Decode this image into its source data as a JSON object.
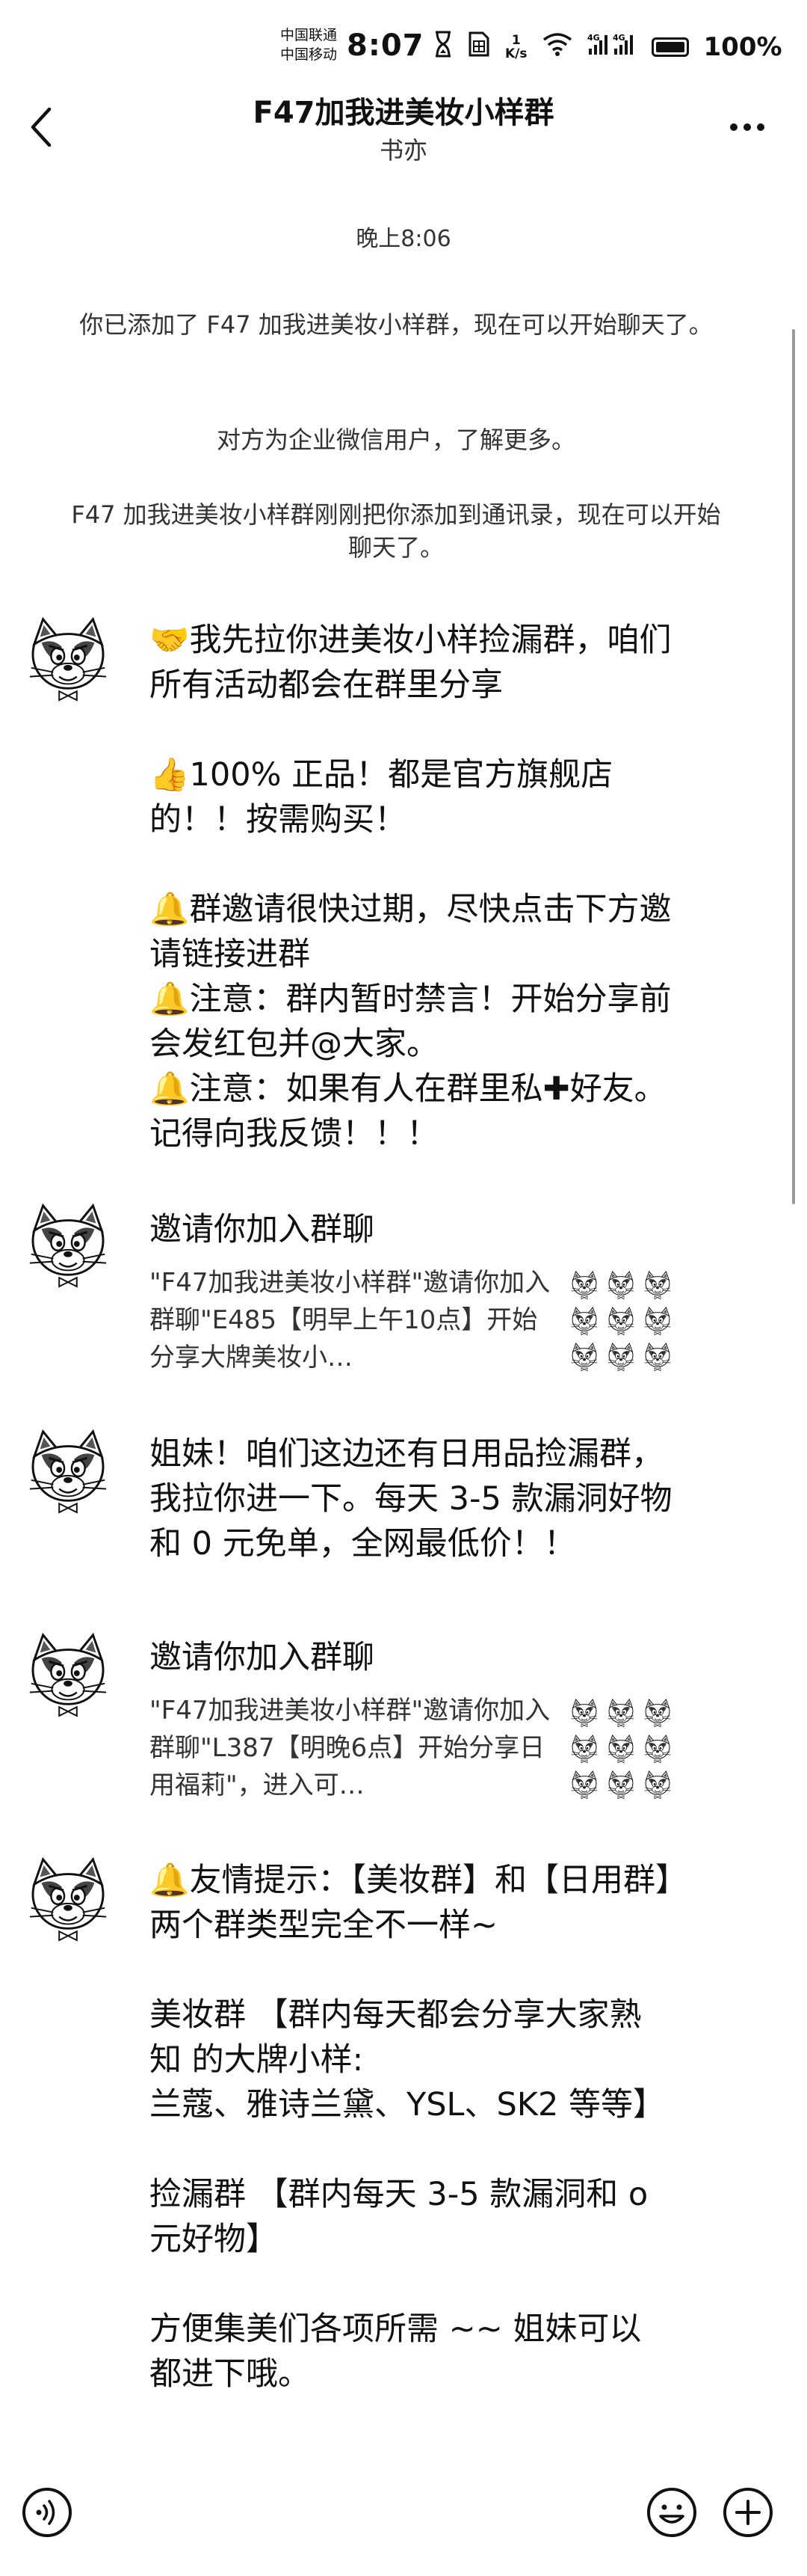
{
  "status_bar": {
    "carrier_1": "中国联通",
    "carrier_2": "中国移动",
    "time": "8:07",
    "net_speed_value": "1",
    "net_speed_unit": "K/s",
    "network_1": "4G",
    "network_2": "4G",
    "battery": "100%",
    "icons": [
      "hourglass-icon",
      "sim-icon",
      "wifi-icon",
      "signal-icon",
      "battery-icon"
    ]
  },
  "nav": {
    "title": "F47加我进美妆小样群",
    "subtitle": "书亦",
    "back_icon": "back-chevron-icon",
    "more_icon": "more-dots-icon"
  },
  "system_messages": {
    "timestamp": "晚上8:06",
    "added": "你已添加了 F47 加我进美妆小样群，现在可以开始聊天了。",
    "enterprise": "对方为企业微信用户，了解更多。",
    "contact_added": "F47 加我进美妆小样群刚刚把你添加到通讯录，现在可以开始聊天了。"
  },
  "messages": [
    {
      "type": "text",
      "text": "🤝我先拉你进美妆小样捡漏群，咱们所有活动都会在群里分享\n\n👍100% 正品！都是官方旗舰店的！！按需购买！\n\n🔔群邀请很快过期，尽快点击下方邀请链接进群\n🔔注意：群内暂时禁言！开始分享前会发红包并@大家。\n🔔注意：如果有人在群里私✚好友。记得向我反馈！！！"
    },
    {
      "type": "card",
      "title": "邀请你加入群聊",
      "description": "\"F47加我进美妆小样群\"邀请你加入群聊\"E485【明早上午10点】开始分享大牌美妆小…"
    },
    {
      "type": "text",
      "text": "姐妹！咱们这边还有日用品捡漏群，我拉你进一下。每天 3-5 款漏洞好物和 0 元免单，全网最低价！！"
    },
    {
      "type": "card",
      "title": "邀请你加入群聊",
      "description": "\"F47加我进美妆小样群\"邀请你加入群聊\"L387【明晚6点】开始分享日用福莉\"，进入可…"
    },
    {
      "type": "text",
      "text": "🔔友情提示：【美妆群】和【日用群】两个群类型完全不一样~\n\n美妆群 【群内每天都会分享大家熟知 的大牌小样:\n兰蔻、雅诗兰黛、YSL、SK2 等等】\n\n捡漏群 【群内每天 3-5 款漏洞和 o 元好物】\n\n方便集美们各项所需 ~~ 姐妹可以都进下哦。"
    }
  ],
  "bottom_bar": {
    "voice_icon": "voice-icon",
    "emoji_icon": "emoji-icon",
    "plus_icon": "plus-icon"
  }
}
